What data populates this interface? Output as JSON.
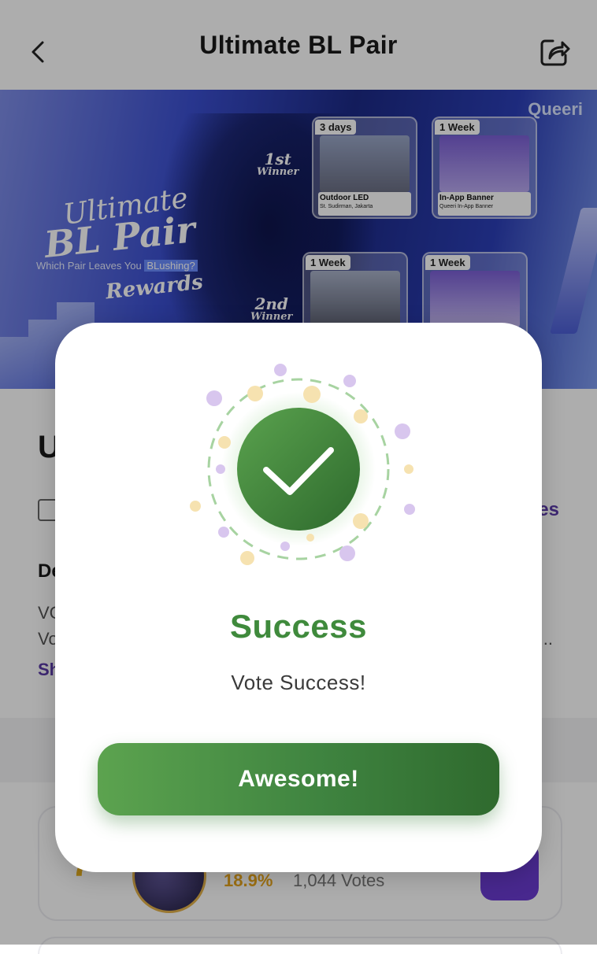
{
  "header": {
    "title": "Ultimate BL Pair"
  },
  "banner": {
    "brand": "Queeri",
    "logo_line1": "Ultimate",
    "logo_line2": "BL Pair",
    "tagline_before": "Which Pair Leaves You ",
    "tagline_highlight": "BLushing?",
    "rewards": "Rewards",
    "first_place": {
      "big": "1st",
      "small": "Winner"
    },
    "second_place": {
      "big": "2nd",
      "small": "Winner"
    },
    "cards": [
      {
        "duration": "3 days",
        "caption": "Outdoor LED",
        "subcaption": "St. Sudirman, Jakarta"
      },
      {
        "duration": "1 Week",
        "caption": "In-App Banner",
        "subcaption": "Queeri In-App Banner"
      },
      {
        "duration": "1 Week",
        "caption": "",
        "subcaption": ""
      },
      {
        "duration": "1 Week",
        "caption": "",
        "subcaption": ""
      }
    ]
  },
  "content": {
    "title_partial": "U",
    "votes_link_partial": "es",
    "desc_heading_partial": "De",
    "desc_line1_partial": "VC",
    "desc_line2_partial": "Vo",
    "ellipsis": "...",
    "show_more_partial": "Sh"
  },
  "entry": {
    "rank": "7",
    "percent": "18.9%",
    "votes": "1,044 Votes"
  },
  "modal": {
    "heading": "Success",
    "message": "Vote Success!",
    "button_label": "Awesome!"
  },
  "colors": {
    "success_green": "#3f8a3c",
    "accent_purple": "#6a3bd1",
    "rank_gold": "#e8b020"
  }
}
